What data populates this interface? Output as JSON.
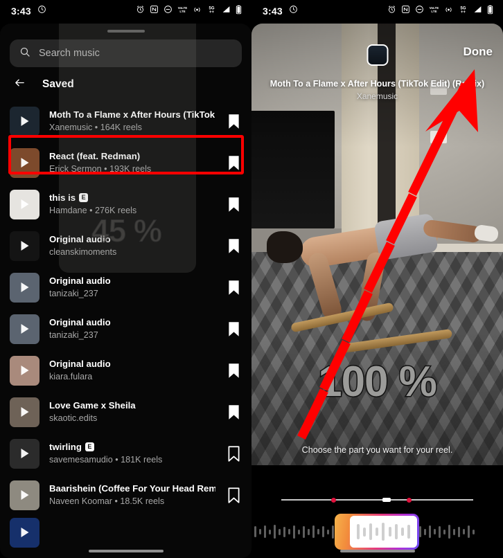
{
  "status_bar": {
    "time": "3:43",
    "left_icons": [
      "record-indicator-icon"
    ],
    "right_icons": [
      "alarm-icon",
      "nfc-icon",
      "do-not-disturb-icon",
      "volte-icon",
      "hotspot-icon",
      "5g-icon",
      "signal-bars-icon",
      "battery-icon"
    ]
  },
  "left_screen": {
    "search": {
      "placeholder": "Search music",
      "icon": "search-icon"
    },
    "header": {
      "back_icon": "back-arrow-icon",
      "title": "Saved"
    },
    "overlay_percent": "45 %",
    "tracks": [
      {
        "title": "Moth To a Flame x After Hours (TikTok Edit)…",
        "subtitle": "Xanemusic • 164K reels",
        "explicit": false,
        "saved": true,
        "highlighted": true,
        "thumb_color": "#1c2630"
      },
      {
        "title": "React (feat. Redman)",
        "subtitle": "Erick Sermon • 193K reels",
        "explicit": false,
        "saved": true,
        "highlighted": false,
        "thumb_color": "#7d4a2c"
      },
      {
        "title": "this is",
        "subtitle": "Hamdane • 276K reels",
        "explicit": true,
        "saved": true,
        "highlighted": false,
        "thumb_color": "#e6e4e0"
      },
      {
        "title": "Original audio",
        "subtitle": "cleanskimoments",
        "explicit": false,
        "saved": true,
        "highlighted": false,
        "thumb_color": "#141414"
      },
      {
        "title": "Original audio",
        "subtitle": "tanizaki_237",
        "explicit": false,
        "saved": true,
        "highlighted": false,
        "thumb_color": "#5b6470"
      },
      {
        "title": "Original audio",
        "subtitle": "tanizaki_237",
        "explicit": false,
        "saved": true,
        "highlighted": false,
        "thumb_color": "#5b6470"
      },
      {
        "title": "Original audio",
        "subtitle": "kiara.fulara",
        "explicit": false,
        "saved": true,
        "highlighted": false,
        "thumb_color": "#a98a7c"
      },
      {
        "title": "Love Game x Sheila",
        "subtitle": "skaotic.edits",
        "explicit": false,
        "saved": true,
        "highlighted": false,
        "thumb_color": "#6e6257"
      },
      {
        "title": "twirling",
        "subtitle": "savemesamudio • 181K reels",
        "explicit": true,
        "saved": false,
        "highlighted": false,
        "thumb_color": "#2b2b2b"
      },
      {
        "title": "Baarishein (Coffee For Your Head Remix) [f…",
        "subtitle": "Naveen Koomar • 18.5K reels",
        "explicit": false,
        "saved": false,
        "highlighted": false,
        "thumb_color": "#8e8a80"
      },
      {
        "title": "",
        "subtitle": "",
        "explicit": false,
        "saved": false,
        "highlighted": false,
        "thumb_color": "#16306b"
      }
    ]
  },
  "right_screen": {
    "done_label": "Done",
    "album_chip": "album-art-thumbnail",
    "song_title": "Moth To a Flame x After Hours (TikTok Edit) (Remix)",
    "song_artist": "Xanemusic",
    "video_overlay_percent": "100 %",
    "hint": "Choose the part you want for your reel.",
    "timeline": {
      "dots": 2,
      "cursor": "playhead-marker"
    },
    "trimmer": {
      "selection_label": "audio-trim-selection"
    }
  },
  "annotation": {
    "arrow_color": "#ff0000",
    "highlight_color": "#ff0000"
  }
}
